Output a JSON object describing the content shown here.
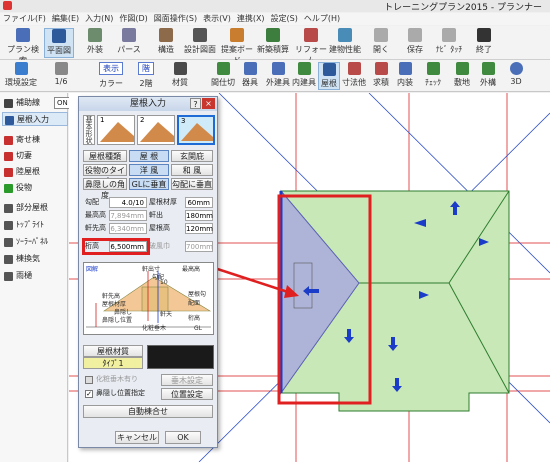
{
  "window": {
    "title": "トレーニングプラン2015 - プランナー"
  },
  "menu": [
    "ファイル(F)",
    "編集(E)",
    "入力(N)",
    "作図(D)",
    "図面操作(S)",
    "表示(V)",
    "連携(X)",
    "設定(S)",
    "ヘルプ(H)"
  ],
  "toolbar1": [
    {
      "label": "プラン検索"
    },
    {
      "label": "平面図"
    },
    {
      "label": "外装"
    },
    {
      "label": "パース"
    },
    {
      "label": "構造"
    },
    {
      "label": "設計図面"
    },
    {
      "label": "提案ボード"
    },
    {
      "label": "新築積算"
    },
    {
      "label": "リフォーム"
    },
    {
      "label": "建物性能"
    },
    {
      "label": "開く"
    },
    {
      "label": "保存"
    },
    {
      "label": "ﾅﾋﾞ ﾀｯﾁ"
    },
    {
      "label": "終了"
    }
  ],
  "toolbar2_left": {
    "env": "環境設定",
    "scale": "1/6",
    "display": "表示",
    "floor": "階",
    "color": "カラー",
    "floor2": "2階",
    "material": "材質"
  },
  "toolbar2": [
    {
      "label": "間仕切"
    },
    {
      "label": "器具"
    },
    {
      "label": "外建具"
    },
    {
      "label": "内建具"
    },
    {
      "label": "屋根"
    },
    {
      "label": "寸法他"
    },
    {
      "label": "求積"
    },
    {
      "label": "内装"
    },
    {
      "label": "ﾁｪｯｸ"
    },
    {
      "label": "敷地"
    },
    {
      "label": "外構"
    },
    {
      "label": "3D"
    }
  ],
  "sidebar": {
    "items": [
      "補助線",
      "屋根入力",
      "寄せ棟",
      "切妻",
      "陸屋根",
      "役物",
      "部分屋根",
      "ﾄｯﾌﾟﾗｲﾄ",
      "ｿｰﾗｰﾊﾟﾈﾙ",
      "棟換気",
      "雨樋"
    ],
    "on_label": "ON"
  },
  "dialog": {
    "title": "屋根入力",
    "help": "?",
    "close": "×",
    "shape_label": "基本形状",
    "shapes": [
      "1",
      "2",
      "3"
    ],
    "row1": [
      "屋根種類",
      "屋 根",
      "玄関庇"
    ],
    "row2": [
      "役物のタイプ",
      "洋 風",
      "和 風"
    ],
    "row3": [
      "鼻隠しの角度",
      "GLに垂直",
      "勾配に垂直"
    ],
    "fields": [
      {
        "label": "勾配",
        "value": "4.0/10",
        "label2": "屋根材厚",
        "value2": "60mm"
      },
      {
        "label": "最高高",
        "value": "7,894mm",
        "label2": "軒出",
        "value2": "180mm"
      },
      {
        "label": "軒先高",
        "value": "6,340mm",
        "label2": "屋根高",
        "value2": "120mm"
      },
      {
        "label": "桁高",
        "value": "6,500mm",
        "label2": "破風巾",
        "value2": "700mm"
      }
    ],
    "section_label": "図解",
    "section_texts": [
      "軒出寸",
      "最高高",
      "勾配",
      "10",
      "軒先高",
      "屋根材厚",
      "鼻隠し",
      "鼻隠し位置",
      "化粧垂木",
      "軒天",
      "屋根勾配面",
      "桁高",
      "GL"
    ],
    "material_label": "屋根材質",
    "material_type": "ﾀｲﾌﾟ1",
    "check1": "化粧垂木有り",
    "btn_rafter": "垂木設定",
    "check2": "鼻隠し位置指定",
    "btn_pos": "位置設定",
    "btn_auto": "自動棟合せ",
    "cancel": "キャンセル",
    "ok": "OK"
  },
  "colors": {
    "roof_green": "#c8e8b8",
    "red": "#e02020",
    "blue": "#2a4fd6",
    "accent": "#1e6bd6"
  }
}
